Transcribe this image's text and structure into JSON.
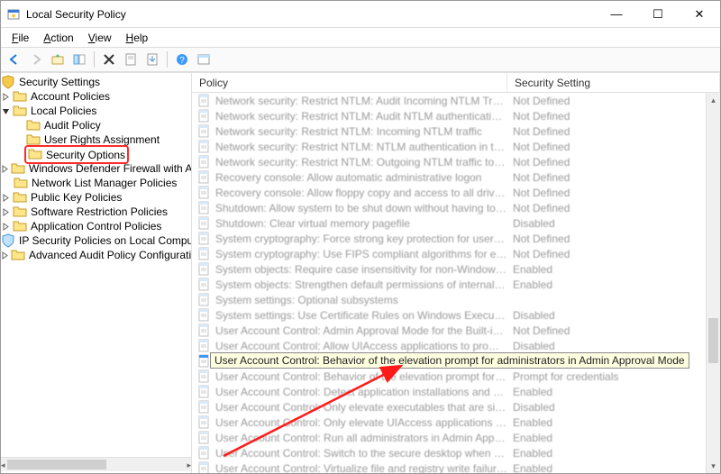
{
  "window": {
    "title": "Local Security Policy",
    "buttons": {
      "min": "—",
      "max": "☐",
      "close": "✕"
    }
  },
  "menu": {
    "file": "File",
    "action": "Action",
    "view": "View",
    "help": "Help"
  },
  "tree": {
    "root": "Security Settings",
    "account_policies": "Account Policies",
    "local_policies": "Local Policies",
    "audit_policy": "Audit Policy",
    "user_rights": "User Rights Assignment",
    "security_options": "Security Options",
    "defender": "Windows Defender Firewall with Advanced Security",
    "nlmp": "Network List Manager Policies",
    "pkp": "Public Key Policies",
    "srp": "Software Restriction Policies",
    "acp": "Application Control Policies",
    "ipsec": "IP Security Policies on Local Computer",
    "aapc": "Advanced Audit Policy Configuration"
  },
  "columns": {
    "policy": "Policy",
    "setting": "Security Setting"
  },
  "settings": {
    "not_defined": "Not Defined",
    "enabled": "Enabled",
    "disabled": "Disabled",
    "prompt": "Prompt for credentials"
  },
  "tooltip": "User Account Control: Behavior of the elevation prompt for administrators in Admin Approval Mode",
  "policies": [
    {
      "n": "Network security: Restrict NTLM: Audit Incoming NTLM Traffic",
      "s": "not_defined"
    },
    {
      "n": "Network security: Restrict NTLM: Audit NTLM authentication i...",
      "s": "not_defined"
    },
    {
      "n": "Network security: Restrict NTLM: Incoming NTLM traffic",
      "s": "not_defined"
    },
    {
      "n": "Network security: Restrict NTLM: NTLM authentication in this ...",
      "s": "not_defined"
    },
    {
      "n": "Network security: Restrict NTLM: Outgoing NTLM traffic to re...",
      "s": "not_defined"
    },
    {
      "n": "Recovery console: Allow automatic administrative logon",
      "s": "not_defined"
    },
    {
      "n": "Recovery console: Allow floppy copy and access to all drives a...",
      "s": "not_defined"
    },
    {
      "n": "Shutdown: Allow system to be shut down without having to l...",
      "s": "not_defined"
    },
    {
      "n": "Shutdown: Clear virtual memory pagefile",
      "s": "disabled"
    },
    {
      "n": "System cryptography: Force strong key protection for user ke...",
      "s": "not_defined"
    },
    {
      "n": "System cryptography: Use FIPS compliant algorithms for encr...",
      "s": "not_defined"
    },
    {
      "n": "System objects: Require case insensitivity for non-Windows s...",
      "s": "enabled"
    },
    {
      "n": "System objects: Strengthen default permissions of internal sy...",
      "s": "enabled"
    },
    {
      "n": "System settings: Optional subsystems",
      "s": ""
    },
    {
      "n": "System settings: Use Certificate Rules on Windows Executable...",
      "s": "disabled"
    },
    {
      "n": "User Account Control: Admin Approval Mode for the Built-in ...",
      "s": "not_defined"
    },
    {
      "n": "User Account Control: Allow UIAccess applications to prompt ...",
      "s": "disabled"
    },
    {
      "n": "User Account Control: Behavior of the elevation prompt for administrators in Admin Approval Mode",
      "s": "",
      "hl": true
    },
    {
      "n": "User Account Control: Behavior of the elevation prompt for st...",
      "s": "prompt"
    },
    {
      "n": "User Account Control: Detect application installations and pr...",
      "s": "enabled"
    },
    {
      "n": "User Account Control: Only elevate executables that are signe...",
      "s": "disabled"
    },
    {
      "n": "User Account Control: Only elevate UIAccess applications that...",
      "s": "enabled"
    },
    {
      "n": "User Account Control: Run all administrators in Admin Appro...",
      "s": "enabled"
    },
    {
      "n": "User Account Control: Switch to the secure desktop when pro...",
      "s": "enabled"
    },
    {
      "n": "User Account Control: Virtualize file and registry write failures...",
      "s": "enabled"
    }
  ]
}
